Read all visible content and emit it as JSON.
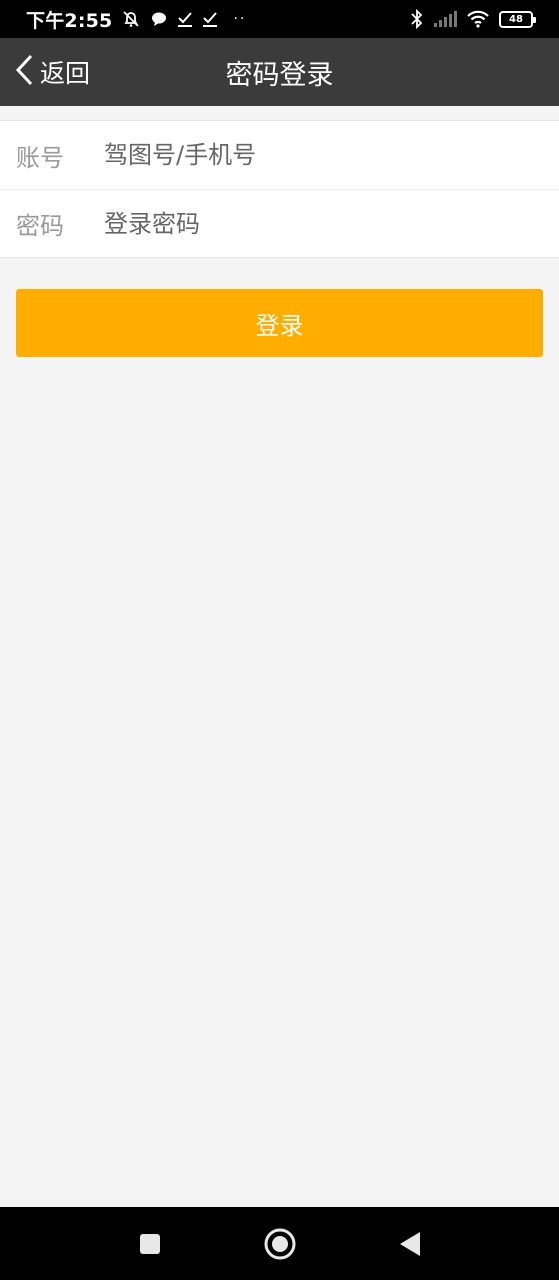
{
  "status_bar": {
    "time": "下午2:55",
    "battery": "48",
    "dots": "··"
  },
  "title_bar": {
    "back_label": "返回",
    "title": "密码登录"
  },
  "form": {
    "account": {
      "label": "账号",
      "placeholder": "驾图号/手机号",
      "value": ""
    },
    "password": {
      "label": "密码",
      "placeholder": "登录密码",
      "value": ""
    }
  },
  "login_button_label": "登录",
  "colors": {
    "title_bar_bg": "#3b3b3b",
    "accent": "#ffae00",
    "page_bg": "#f4f4f4"
  },
  "nav_bar": {
    "icons": [
      "recent-apps-icon",
      "home-icon",
      "back-triangle-icon"
    ]
  }
}
